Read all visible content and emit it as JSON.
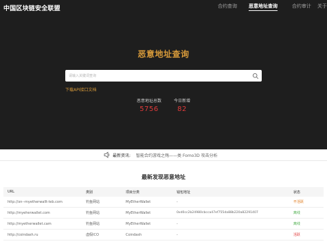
{
  "header": {
    "brand": "中国区块链安全联盟",
    "nav": [
      {
        "label": "合约查询",
        "active": false
      },
      {
        "label": "恶意地址查询",
        "active": true
      },
      {
        "label": "合约审计",
        "active": false
      },
      {
        "label": "关于",
        "active": false
      }
    ]
  },
  "hero": {
    "title": "恶意地址查询",
    "search_placeholder": "请输入关键词查询",
    "api_link": "下载API接口文档",
    "stats": [
      {
        "label": "恶意地址总数",
        "value": "5756"
      },
      {
        "label": "今日新增",
        "value": "82"
      }
    ]
  },
  "news": {
    "label": "最新资讯:",
    "text": "智能合约游戏之殇——类 Fomo3D 攻击分析"
  },
  "table": {
    "title": "最新发现恶意地址",
    "columns": [
      "URL",
      "类别",
      "项目分类",
      "钱包地址",
      "状态"
    ],
    "rows": [
      [
        "http://xn--myetherwallt-leb.com",
        "钓鱼网站",
        "MyEtherWallet",
        "-",
        "不活跃"
      ],
      [
        "http://myeherwallet.com",
        "钓鱼网站",
        "MyEtherWallet",
        "0xd0cc2b24980cbcca47ef755da88b220a82291407",
        "离线"
      ],
      [
        "http://myetherwallet.cam",
        "钓鱼网站",
        "MyEtherWallet",
        "-",
        "离线"
      ],
      [
        "http://coindash.ru",
        "虚假ICO",
        "Coindash",
        "-",
        "活跃"
      ]
    ]
  },
  "colors": {
    "accent": "#d79a3a",
    "stat_red": "#e03b3b",
    "inactive": "#e07b1e",
    "offline": "#4cae4c",
    "active": "#e03b3b"
  }
}
